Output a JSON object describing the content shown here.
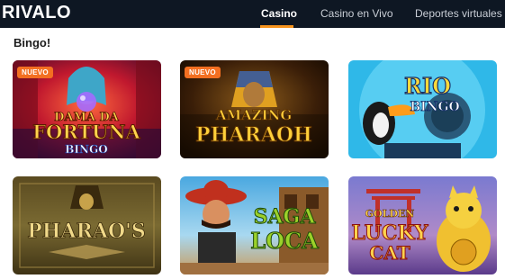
{
  "header": {
    "logo": "RIVALO",
    "tabs": [
      {
        "label": "Casino",
        "active": true
      },
      {
        "label": "Casino en Vivo",
        "active": false
      },
      {
        "label": "Deportes virtuales",
        "active": false
      }
    ]
  },
  "section": {
    "title": "Bingo!"
  },
  "games": [
    {
      "title_line1": "DAMA DA",
      "title_line2": "FORTUNA",
      "title_line3": "BINGO",
      "badge": "NUEVO"
    },
    {
      "title_line1": "AMAZING",
      "title_line2": "PHARAOH",
      "badge": "NUEVO"
    },
    {
      "title_line1": "RIO",
      "title_line2": "BINGO"
    },
    {
      "title_line1": "PHARAO'S"
    },
    {
      "title_line1": "SAGA",
      "title_line2": "LOCA"
    },
    {
      "title_line1": "GOLDEN",
      "title_line2": "LUCKY",
      "title_line3": "CAT"
    }
  ],
  "colors": {
    "topbar": "#0e1723",
    "accent": "#f7941d",
    "badge": "#f36f21"
  }
}
